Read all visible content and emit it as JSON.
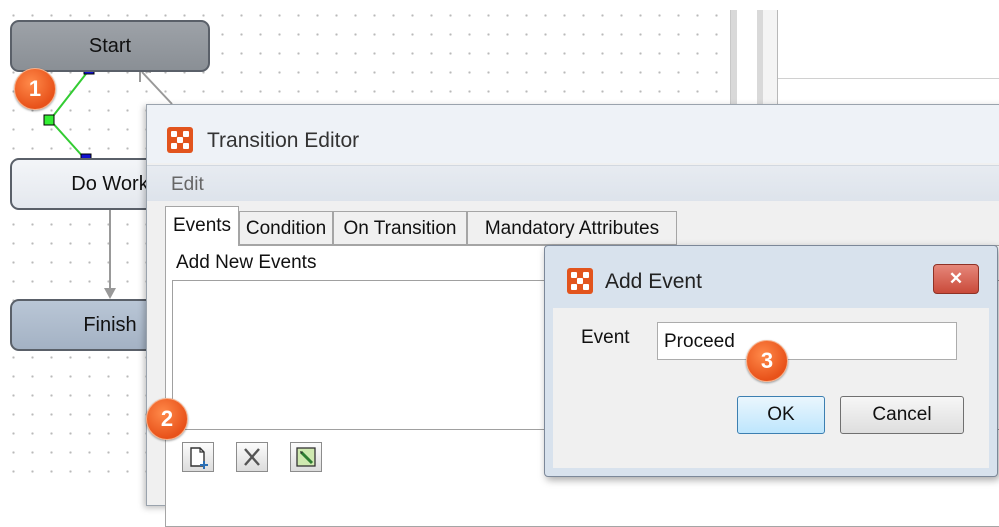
{
  "workflow": {
    "nodes": [
      {
        "label": "Start"
      },
      {
        "label": "Do Work"
      },
      {
        "label": "Finish"
      }
    ]
  },
  "callouts": [
    "1",
    "2",
    "3"
  ],
  "transition_editor": {
    "title": "Transition Editor",
    "menu": {
      "edit": "Edit"
    },
    "tabs": [
      "Events",
      "Condition",
      "On Transition",
      "Mandatory Attributes"
    ],
    "events_pane": {
      "label": "Add New Events"
    },
    "toolbar": [
      {
        "icon": "new-document-icon"
      },
      {
        "icon": "delete-x-icon"
      },
      {
        "icon": "edit-pencil-icon"
      }
    ]
  },
  "add_event_dialog": {
    "title": "Add Event",
    "close_glyph": "✕",
    "field_label": "Event",
    "field_value": "Proceed",
    "ok_label": "OK",
    "cancel_label": "Cancel"
  },
  "colors": {
    "accent": "#e2541d",
    "connector_green": "#33cc33",
    "handle_blue": "#1010d0"
  }
}
